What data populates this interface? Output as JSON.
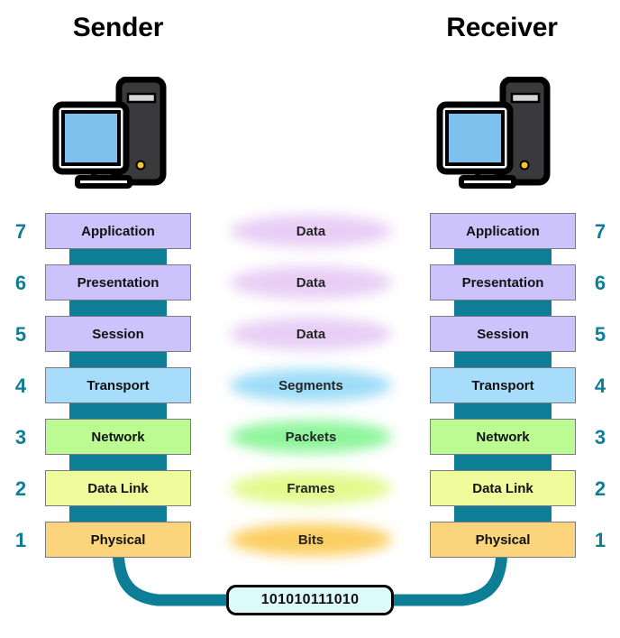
{
  "endpoints": {
    "sender": {
      "title": "Sender",
      "icon": "desktop-computer-icon"
    },
    "receiver": {
      "title": "Receiver",
      "icon": "desktop-computer-icon"
    }
  },
  "layers": [
    {
      "number": "7",
      "name": "Application",
      "color": "#CCC3FC",
      "pdu": "Data",
      "pdu_glow": "#E8CEF5"
    },
    {
      "number": "6",
      "name": "Presentation",
      "color": "#CCC3FC",
      "pdu": "Data",
      "pdu_glow": "#E8CEF5"
    },
    {
      "number": "5",
      "name": "Session",
      "color": "#CCC3FC",
      "pdu": "Data",
      "pdu_glow": "#E8CEF5"
    },
    {
      "number": "4",
      "name": "Transport",
      "color": "#A8DCFB",
      "pdu": "Segments",
      "pdu_glow": "#9DDCF7"
    },
    {
      "number": "3",
      "name": "Network",
      "color": "#BCFB92",
      "pdu": "Packets",
      "pdu_glow": "#8EF59C"
    },
    {
      "number": "2",
      "name": "Data Link",
      "color": "#EEFC9B",
      "pdu": "Frames",
      "pdu_glow": "#E4F98C"
    },
    {
      "number": "1",
      "name": "Physical",
      "color": "#FCD47C",
      "pdu": "Bits",
      "pdu_glow": "#FBCE62"
    }
  ],
  "transmission": {
    "bits_value": "101010111010",
    "cable_color": "#0E7E96",
    "box_fill": "#DDFAFB"
  },
  "colors": {
    "connector_teal": "#0E7E96",
    "number_teal": "#0E7E96",
    "box_border": "#7a7a85",
    "background": "#FFFFFF"
  }
}
